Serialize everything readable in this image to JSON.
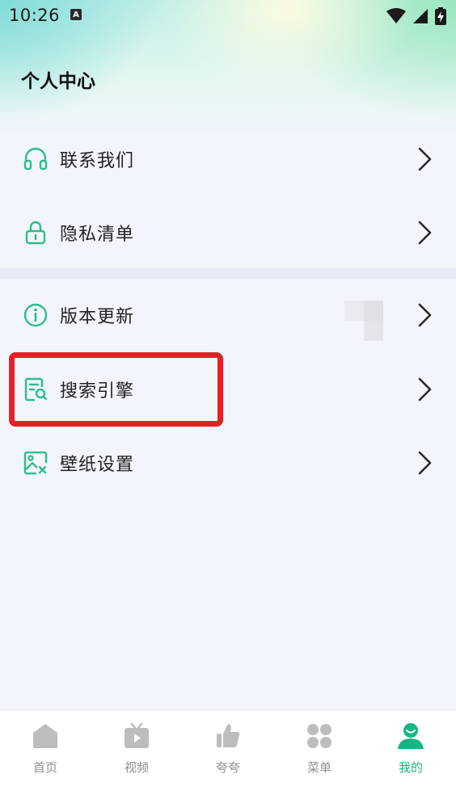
{
  "status_bar": {
    "time": "10:26",
    "notification_badge": "A",
    "icons": [
      "wifi-icon",
      "cellular-signal-icon",
      "battery-charging-icon"
    ]
  },
  "page": {
    "title": "个人中心"
  },
  "menu": {
    "group1": [
      {
        "id": "contact",
        "label": "联系我们",
        "icon": "headphones-icon"
      },
      {
        "id": "privacy",
        "label": "隐私清单",
        "icon": "lock-icon"
      }
    ],
    "group2": [
      {
        "id": "update",
        "label": "版本更新",
        "icon": "info-icon"
      },
      {
        "id": "search-engine",
        "label": "搜索引擎",
        "icon": "search-document-icon"
      },
      {
        "id": "wallpaper",
        "label": "壁纸设置",
        "icon": "wallpaper-icon"
      }
    ]
  },
  "tabs": [
    {
      "label": "首页",
      "icon": "home-icon",
      "active": false
    },
    {
      "label": "视频",
      "icon": "video-tv-icon",
      "active": false
    },
    {
      "label": "夸夸",
      "icon": "thumbs-up-icon",
      "active": false
    },
    {
      "label": "菜单",
      "icon": "grid-menu-icon",
      "active": false
    },
    {
      "label": "我的",
      "icon": "user-profile-icon",
      "active": true
    }
  ],
  "colors": {
    "accent": "#17b583",
    "icon_outline": "#2fbd8a",
    "inactive_tab": "#bdbdbd",
    "highlight_border": "#ea1e28",
    "page_background": "#f3f5fc"
  }
}
